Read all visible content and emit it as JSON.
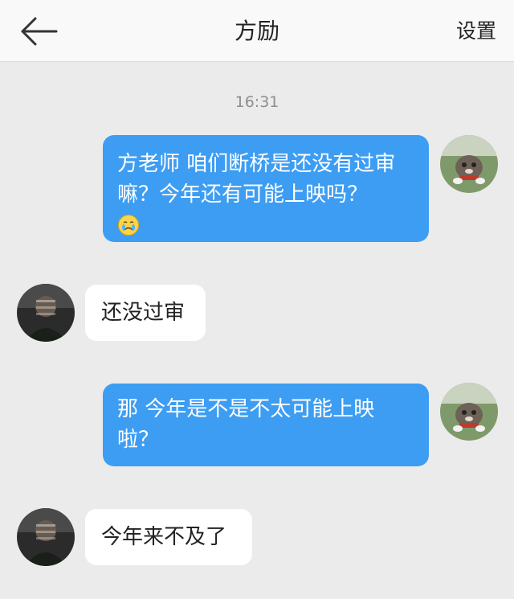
{
  "header": {
    "title": "方励",
    "settings_label": "设置"
  },
  "timestamp": "16:31",
  "messages": [
    {
      "side": "sent",
      "text": "方老师  咱们断桥是还没有过审嘛？今年还有可能上映吗？",
      "emoji": "crying-face"
    },
    {
      "side": "received",
      "text": "还没过审"
    },
    {
      "side": "sent",
      "text": "那 今年是不是不太可能上映啦？"
    },
    {
      "side": "received",
      "text": "今年来不及了"
    }
  ],
  "colors": {
    "sent_bubble": "#3d9df2",
    "received_bubble": "#ffffff",
    "background": "#ebebeb"
  }
}
